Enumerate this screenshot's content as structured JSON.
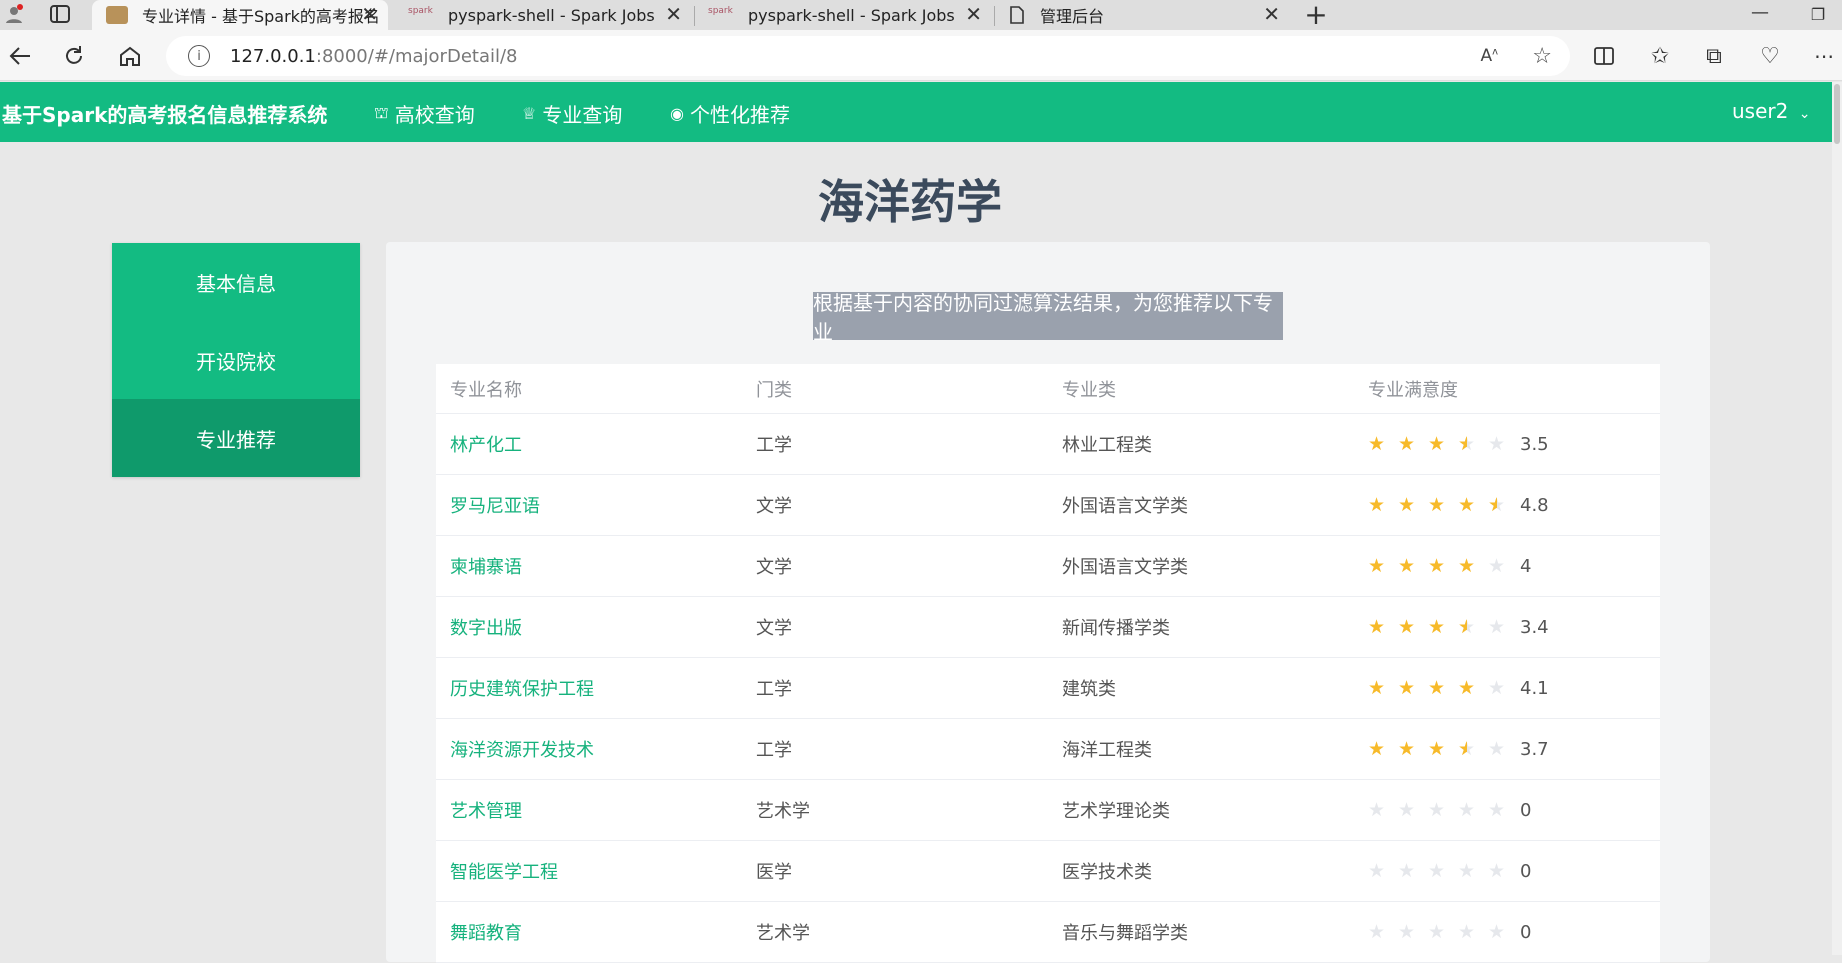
{
  "browser": {
    "tabs": [
      {
        "title": "专业详情 - 基于Spark的高考报名"
      },
      {
        "title": "pyspark-shell - Spark Jobs"
      },
      {
        "title": "pyspark-shell - Spark Jobs"
      },
      {
        "title": "管理后台"
      }
    ],
    "url_host": "127.0.0.1",
    "url_rest": ":8000/#/majorDetail/8"
  },
  "nav": {
    "brand": "基于Spark的高考报名信息推荐系统",
    "items": [
      {
        "label": "高校查询",
        "icon": "chart-icon"
      },
      {
        "label": "专业查询",
        "icon": "trophy-icon"
      },
      {
        "label": "个性化推荐",
        "icon": "target-icon"
      }
    ],
    "user": "user2"
  },
  "page_title": "海洋药学",
  "sidebar": {
    "items": [
      {
        "label": "基本信息"
      },
      {
        "label": "开设院校"
      },
      {
        "label": "专业推荐"
      }
    ]
  },
  "banner": "根据基于内容的协同过滤算法结果，为您推荐以下专业",
  "table": {
    "headers": [
      "专业名称",
      "门类",
      "专业类",
      "专业满意度"
    ],
    "rows": [
      {
        "name": "林产化工",
        "category": "工学",
        "cls": "林业工程类",
        "score": "3.5"
      },
      {
        "name": "罗马尼亚语",
        "category": "文学",
        "cls": "外国语言文学类",
        "score": "4.8"
      },
      {
        "name": "柬埔寨语",
        "category": "文学",
        "cls": "外国语言文学类",
        "score": "4"
      },
      {
        "name": "数字出版",
        "category": "文学",
        "cls": "新闻传播学类",
        "score": "3.4"
      },
      {
        "name": "历史建筑保护工程",
        "category": "工学",
        "cls": "建筑类",
        "score": "4.1"
      },
      {
        "name": "海洋资源开发技术",
        "category": "工学",
        "cls": "海洋工程类",
        "score": "3.7"
      },
      {
        "name": "艺术管理",
        "category": "艺术学",
        "cls": "艺术学理论类",
        "score": "0"
      },
      {
        "name": "智能医学工程",
        "category": "医学",
        "cls": "医学技术类",
        "score": "0"
      },
      {
        "name": "舞蹈教育",
        "category": "艺术学",
        "cls": "音乐与舞蹈学类",
        "score": "0"
      }
    ]
  },
  "colors": {
    "brand": "#13bb82",
    "star": "#f7ba2a"
  }
}
